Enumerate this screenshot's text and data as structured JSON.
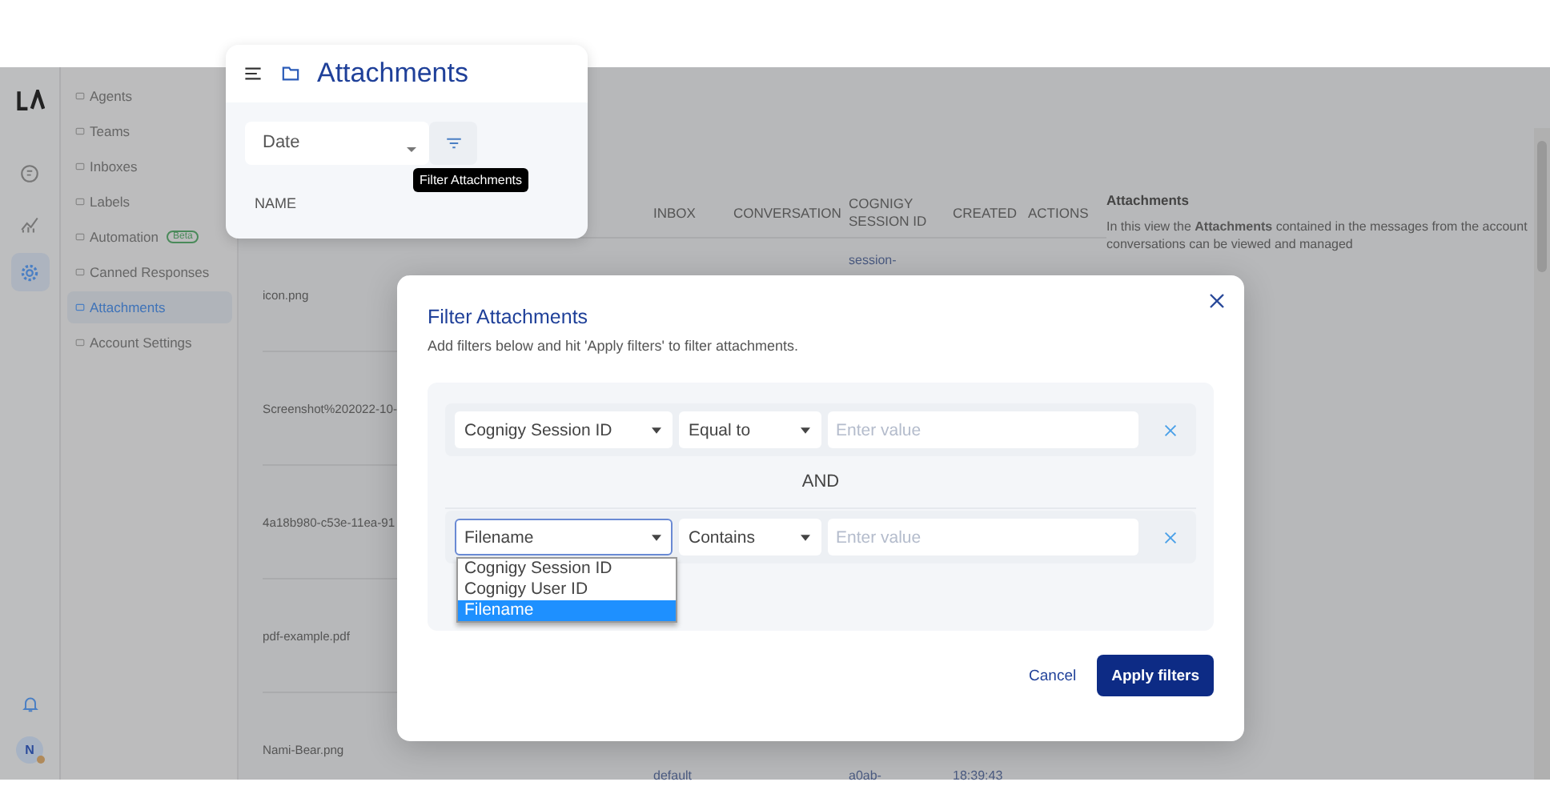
{
  "rail": {
    "items": [
      {
        "kind": "chat",
        "selected": false
      },
      {
        "kind": "reports",
        "selected": false
      },
      {
        "kind": "settings",
        "selected": true
      }
    ],
    "avatar": "N"
  },
  "sidebar": {
    "items": [
      {
        "label": "Agents",
        "selected": false
      },
      {
        "label": "Teams",
        "selected": false
      },
      {
        "label": "Inboxes",
        "selected": false
      },
      {
        "label": "Labels",
        "selected": false
      },
      {
        "label": "Automation",
        "badge": "Beta",
        "selected": false
      },
      {
        "label": "Canned Responses",
        "selected": false
      },
      {
        "label": "Attachments",
        "selected": true
      },
      {
        "label": "Account Settings",
        "selected": false
      }
    ]
  },
  "header_card": {
    "title": "Attachments",
    "sort_select": "Date",
    "tooltip": "Filter Attachments",
    "name_column": "NAME"
  },
  "table": {
    "columns": [
      "INBOX",
      "CONVERSATION",
      "COGNIGY SESSION ID",
      "CREATED",
      "ACTIONS"
    ],
    "rows": [
      {
        "name": "icon.png",
        "cells": {
          "session": [
            "session-"
          ]
        }
      },
      {
        "name": "Screenshot%202022-10-"
      },
      {
        "name": "4a18b980-c53e-11ea-91"
      },
      {
        "name": "pdf-example.pdf"
      },
      {
        "name": "Nami-Bear.png",
        "cells": {
          "inbox": [
            "default"
          ],
          "session": [
            "a0ab-"
          ],
          "created": [
            "18:39:43"
          ]
        }
      }
    ]
  },
  "info_panel": {
    "title": "Attachments",
    "text": "In this view the **Attachments** contained in the messages from the account conversations can be viewed and managed"
  },
  "modal": {
    "title": "Filter Attachments",
    "subtitle": "Add filters below and hit 'Apply filters' to filter attachments.",
    "filters": [
      {
        "attribute": "Cognigy Session ID",
        "operator": "Equal to",
        "placeholder": "Enter value",
        "focused": false
      },
      {
        "attribute": "Filename",
        "operator": "Contains",
        "placeholder": "Enter value",
        "focused": true
      }
    ],
    "conjunction": "AND",
    "dropdown": {
      "options": [
        {
          "label": "Cognigy Session ID",
          "selected": false
        },
        {
          "label": "Cognigy User ID",
          "selected": false
        },
        {
          "label": "Filename",
          "selected": true
        }
      ]
    },
    "cancel": "Cancel",
    "apply": "Apply filters"
  }
}
